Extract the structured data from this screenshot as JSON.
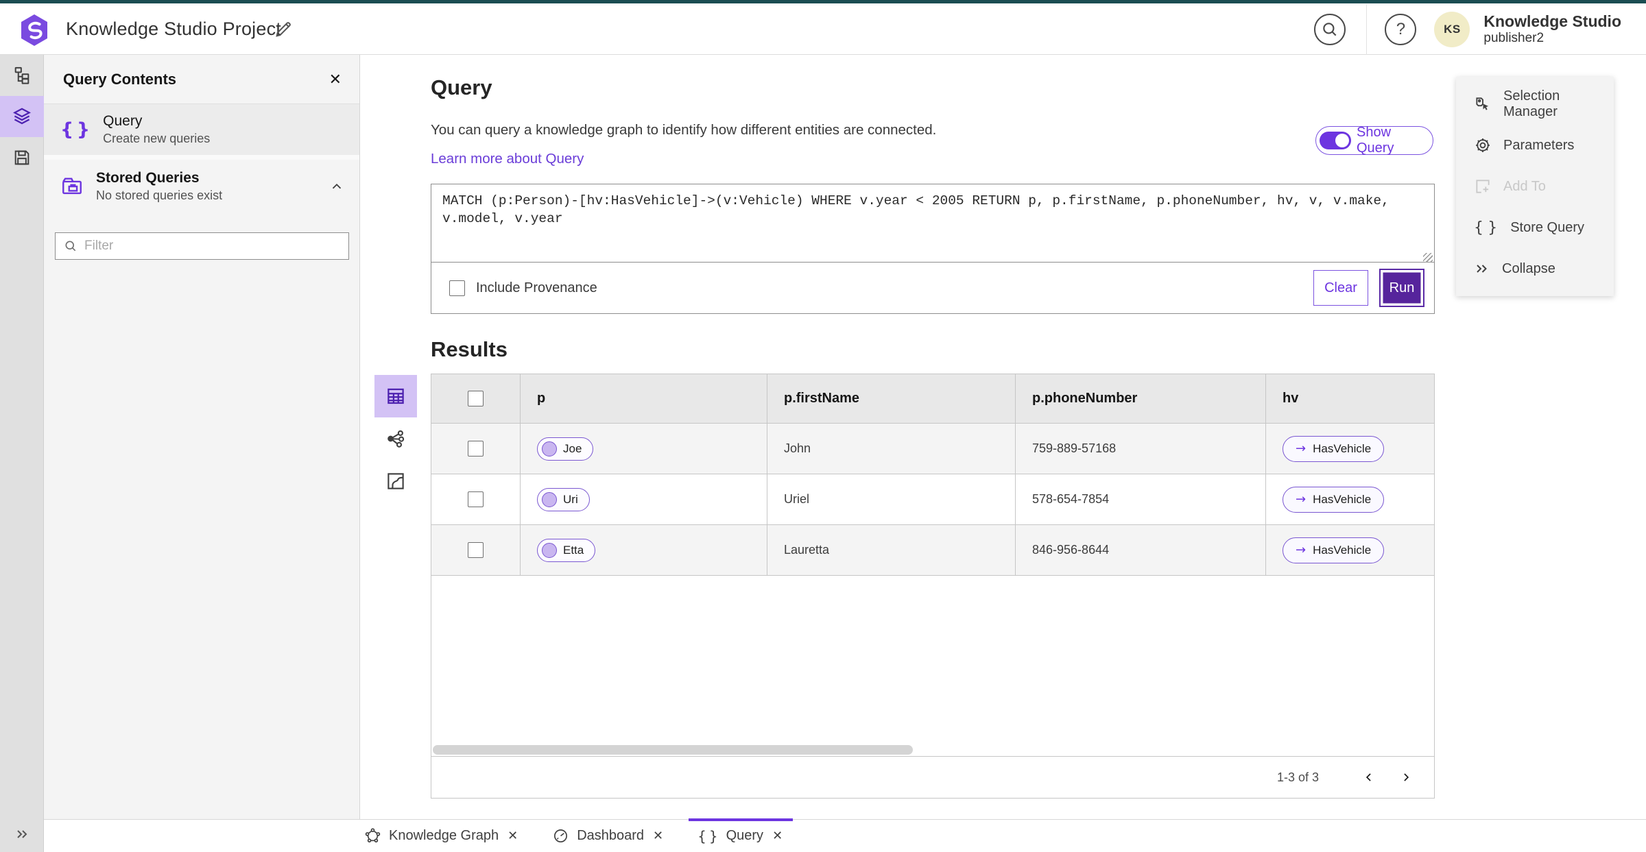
{
  "header": {
    "title": "Knowledge Studio Project",
    "product_name": "Knowledge Studio",
    "user_name": "publisher2",
    "avatar_initials": "KS"
  },
  "left_rail": {
    "items": [
      {
        "icon": "model-hierarchy-icon"
      },
      {
        "icon": "layers-icon",
        "active": true
      },
      {
        "icon": "save-icon"
      }
    ],
    "expand_icon": "double-chevron-right-icon"
  },
  "panel": {
    "title": "Query Contents",
    "query_item": {
      "label": "Query",
      "description": "Create new queries",
      "icon": "braces-icon"
    },
    "stored_item": {
      "label": "Stored Queries",
      "description": "No stored queries exist",
      "icon": "stored-folder-icon"
    },
    "filter_placeholder": "Filter"
  },
  "query_section": {
    "heading": "Query",
    "description": "You can query a knowledge graph to identify how different entities are connected.",
    "learn_more": "Learn more about Query",
    "show_query_label": "Show Query",
    "show_query_on": true,
    "query_text": "MATCH (p:Person)-[hv:HasVehicle]->(v:Vehicle) WHERE v.year < 2005 RETURN p, p.firstName, p.phoneNumber, hv, v, v.make, v.model, v.year",
    "include_provenance_label": "Include Provenance",
    "include_provenance_checked": false,
    "clear_label": "Clear",
    "run_label": "Run"
  },
  "results": {
    "heading": "Results",
    "view_switcher": [
      "table-view-icon",
      "graph-view-icon",
      "map-view-icon"
    ],
    "active_view": "table",
    "columns": [
      "p",
      "p.firstName",
      "p.phoneNumber",
      "hv"
    ],
    "rows": [
      {
        "p": "Joe",
        "firstName": "John",
        "phoneNumber": "759-889-57168",
        "hv": "HasVehicle"
      },
      {
        "p": "Uri",
        "firstName": "Uriel",
        "phoneNumber": "578-654-7854",
        "hv": "HasVehicle"
      },
      {
        "p": "Etta",
        "firstName": "Lauretta",
        "phoneNumber": "846-956-8644",
        "hv": "HasVehicle"
      }
    ],
    "pagination": {
      "range_label": "1-3 of 3"
    }
  },
  "side_menu": {
    "items": [
      {
        "label": "Selection Manager",
        "icon": "selection-tag-cursor-icon",
        "disabled": false
      },
      {
        "label": "Parameters",
        "icon": "gear-icon",
        "disabled": false
      },
      {
        "label": "Add To",
        "icon": "square-plus-icon",
        "disabled": true
      },
      {
        "label": "Store Query",
        "icon": "braces-icon",
        "disabled": false
      },
      {
        "label": "Collapse",
        "icon": "double-chevron-right-icon",
        "disabled": false
      }
    ]
  },
  "tabs": [
    {
      "label": "Knowledge Graph",
      "icon": "graph-pentagon-icon",
      "active": false
    },
    {
      "label": "Dashboard",
      "icon": "gauge-icon",
      "active": false
    },
    {
      "label": "Query",
      "icon": "braces-icon",
      "active": true
    }
  ],
  "colors": {
    "accent": "#6d35e0",
    "accent_deep": "#56249c",
    "accent_light_bg": "#d3c2f5",
    "top_strip_teal": "#1b4d52",
    "avatar_bg": "#f1ecc7",
    "panel_bg": "#f4f4f4",
    "table_header_bg": "#e8e8e8",
    "row_alt_bg": "#f4f4f4"
  }
}
